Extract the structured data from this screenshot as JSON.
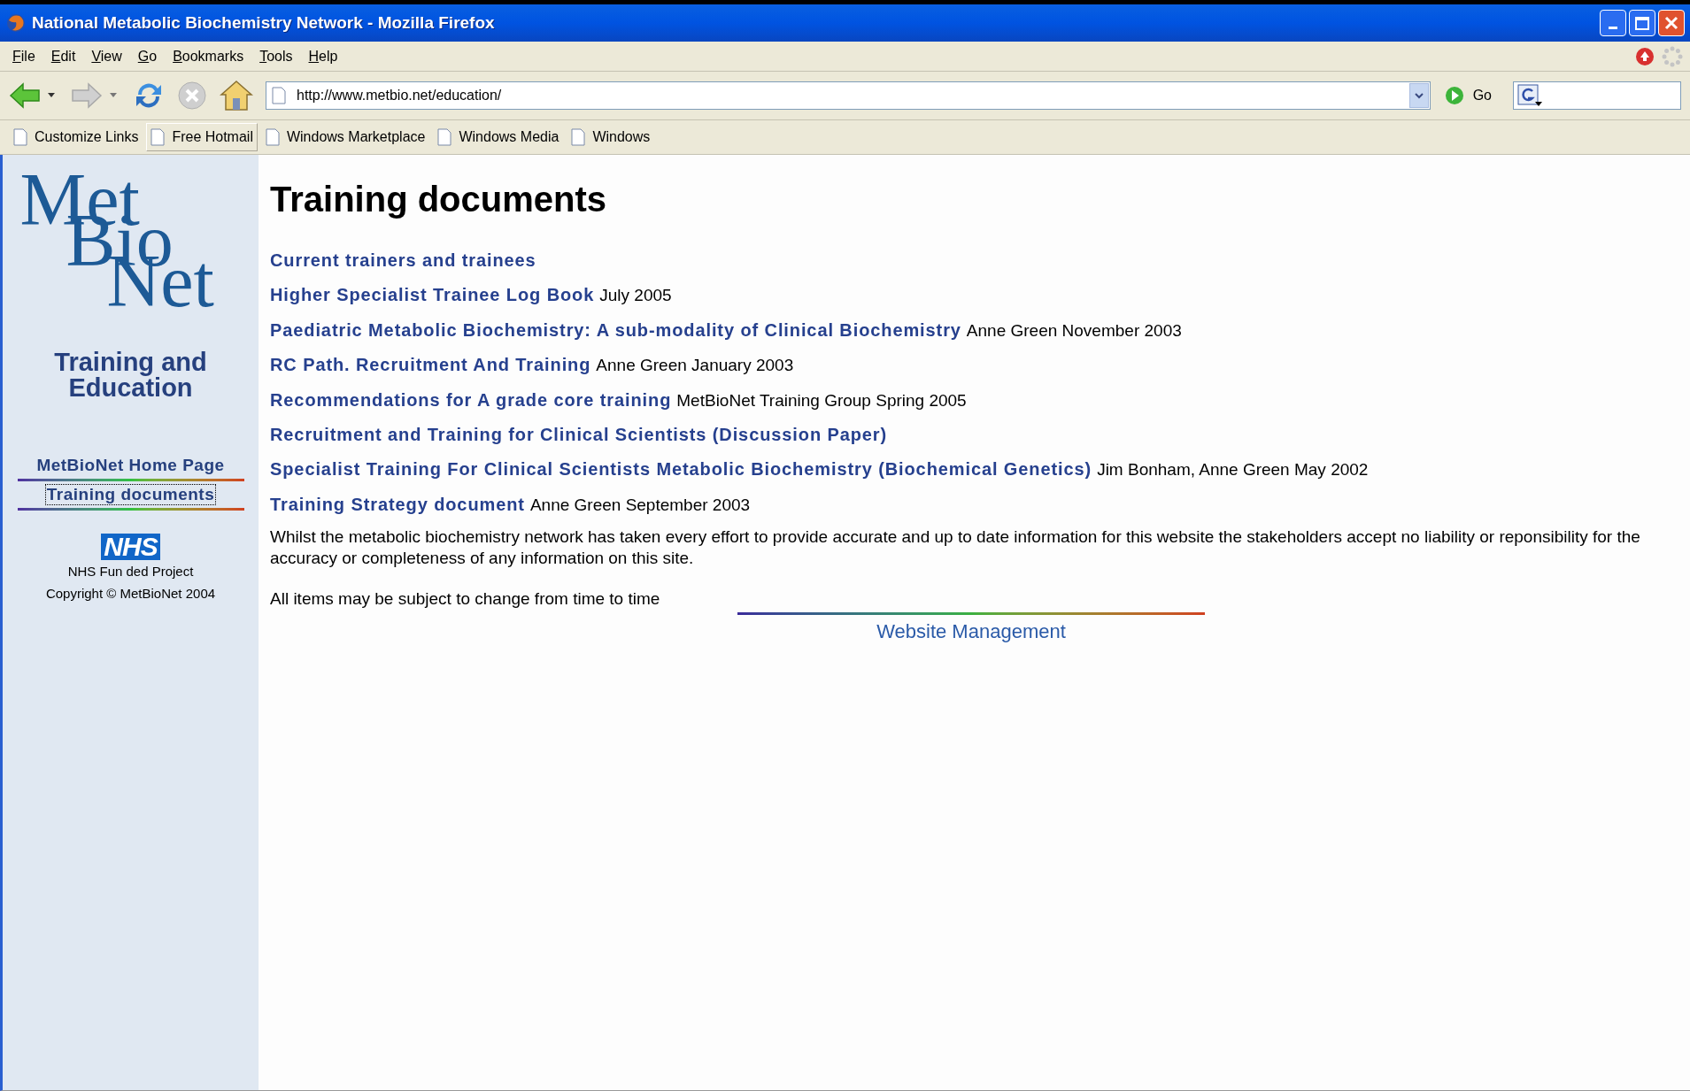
{
  "window": {
    "title": "National Metabolic Biochemistry Network - Mozilla Firefox"
  },
  "menu": [
    "File",
    "Edit",
    "View",
    "Go",
    "Bookmarks",
    "Tools",
    "Help"
  ],
  "address_bar": {
    "url": "http://www.metbio.net/education/",
    "go": "Go"
  },
  "bookmarks": [
    {
      "label": "Customize Links",
      "highlighted": false
    },
    {
      "label": "Free Hotmail",
      "highlighted": true
    },
    {
      "label": "Windows Marketplace",
      "highlighted": false
    },
    {
      "label": "Windows Media",
      "highlighted": false
    },
    {
      "label": "Windows",
      "highlighted": false
    }
  ],
  "sidebar": {
    "logo": [
      "Met",
      "Bio",
      "Net"
    ],
    "heading": "Training and Education",
    "nav": [
      {
        "label": "MetBioNet Home Page",
        "selected": false
      },
      {
        "label": "Training documents",
        "selected": true
      }
    ],
    "nhs_logo": "NHS",
    "funding": "NHS Fun ded Project",
    "copyright": "Copyright © MetBioNet 2004"
  },
  "page": {
    "heading": "Training documents",
    "documents": [
      {
        "title": "Current trainers and trainees"
      },
      {
        "title": "Higher Specialist Trainee Log Book",
        "details": "July 2005"
      },
      {
        "title": "Paediatric Metabolic Biochemistry: A sub-modality of Clinical Biochemistry",
        "details": "Anne Green November 2003"
      },
      {
        "title": "RC Path. Recruitment And Training",
        "details": "Anne Green January 2003"
      },
      {
        "title": "Recommendations for A grade core training",
        "details": "MetBioNet Training Group Spring 2005"
      },
      {
        "title": "Recruitment and Training for Clinical Scientists (Discussion Paper)"
      },
      {
        "title": "Specialist Training For Clinical Scientists Metabolic Biochemistry (Biochemical Genetics)",
        "details": "Jim Bonham, Anne Green May 2002"
      },
      {
        "title": "Training Strategy document",
        "details": "Anne Green September 2003"
      }
    ],
    "disclaimer": "Whilst the metabolic biochemistry network has taken every effort to provide accurate and up to date information for this website the stakeholders accept no liability or reponsibility for the accuracy or completeness of any information on this site.",
    "note": "All items may be subject to change from time to time",
    "footer_link": "Website Management"
  }
}
